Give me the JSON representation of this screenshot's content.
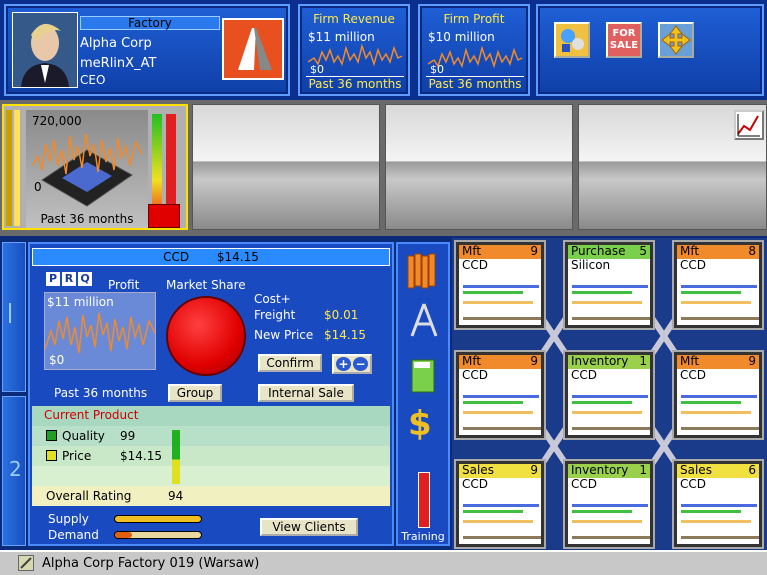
{
  "header": {
    "title_label": "Factory",
    "company": "Alpha Corp",
    "user": "meRlinX_AT",
    "role": "CEO"
  },
  "revenue": {
    "label": "Firm Revenue",
    "value": "$11 million",
    "zero": "$0",
    "period": "Past 36 months"
  },
  "profit": {
    "label": "Firm Profit",
    "value": "$10 million",
    "zero": "$0",
    "period": "Past 36 months"
  },
  "toolbar": {
    "icons": [
      "consultant-icon",
      "for-sale-icon",
      "move-icon"
    ],
    "for_sale_text": "FOR SALE"
  },
  "unit_graph": {
    "max": "720,000",
    "zero": "0",
    "period": "Past 36 months"
  },
  "product": {
    "name": "CCD",
    "price": "$14.15",
    "tabs": [
      "P",
      "R",
      "Q"
    ],
    "profit_label": "Profit",
    "profit_value": "$11 million",
    "profit_zero": "$0",
    "period": "Past 36 months",
    "market_share_label": "Market Share",
    "cost_freight_label1": "Cost+",
    "cost_freight_label2": "Freight",
    "cost_freight_value": "$0.01",
    "new_price_label": "New Price",
    "new_price_value": "$14.15",
    "confirm_label": "Confirm",
    "group_label": "Group",
    "internal_sale_label": "Internal Sale",
    "current_product_label": "Current Product",
    "quality_label": "Quality",
    "quality_value": "99",
    "price_label": "Price",
    "price_value": "$14.15",
    "overall_label": "Overall Rating",
    "overall_value": "94",
    "supply_label": "Supply",
    "demand_label": "Demand",
    "view_clients_label": "View Clients",
    "training_label": "Training"
  },
  "cards": [
    {
      "type": "Mft",
      "count": "9",
      "item": "CCD",
      "color": "#f08a2a"
    },
    {
      "type": "Purchase",
      "count": "5",
      "item": "Silicon",
      "color": "#7ad04a"
    },
    {
      "type": "Mft",
      "count": "8",
      "item": "CCD",
      "color": "#f08a2a"
    },
    {
      "type": "Mft",
      "count": "9",
      "item": "CCD",
      "color": "#f08a2a"
    },
    {
      "type": "Inventory",
      "count": "1",
      "item": "CCD",
      "color": "#9ad04a"
    },
    {
      "type": "Mft",
      "count": "9",
      "item": "CCD",
      "color": "#f08a2a"
    },
    {
      "type": "Sales",
      "count": "9",
      "item": "CCD",
      "color": "#f0e040"
    },
    {
      "type": "Inventory",
      "count": "1",
      "item": "CCD",
      "color": "#9ad04a"
    },
    {
      "type": "Sales",
      "count": "6",
      "item": "CCD",
      "color": "#f0e040"
    }
  ],
  "statusbar": {
    "text": "Alpha Corp Factory 019 (Warsaw)"
  }
}
